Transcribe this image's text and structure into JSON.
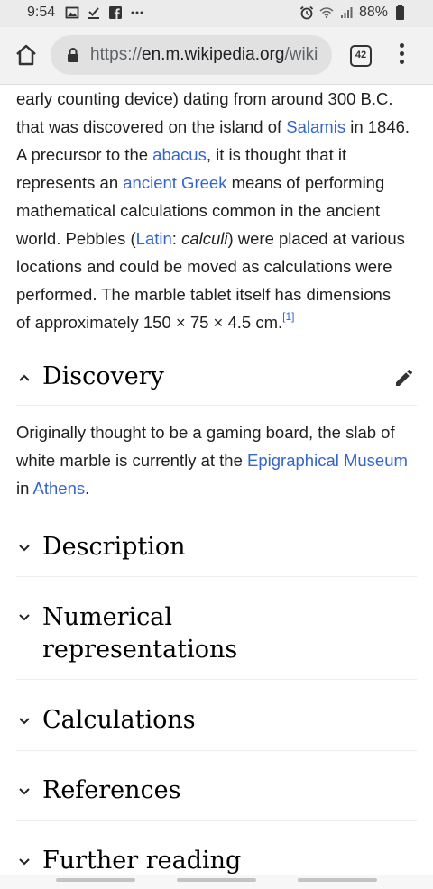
{
  "status_bar": {
    "time": "9:54",
    "battery": "88%",
    "left_icons": [
      "image-icon",
      "download-done-icon",
      "facebook-icon",
      "more-dots-icon"
    ],
    "right_icons": [
      "alarm-icon",
      "wifi-icon",
      "signal-icon",
      "battery-icon"
    ]
  },
  "browser": {
    "url_scheme": "https://",
    "url_host": "en.m.wikipedia.org",
    "url_path": "/wiki",
    "tab_count": "42"
  },
  "article": {
    "lines": [
      "early counting device) dating from around 300 B.C.",
      "that was discovered on the island of ",
      "Salamis",
      " in 1846.",
      "A precursor to the ",
      "abacus",
      ", it is thought that it",
      "represents an ",
      "ancient Greek",
      " means of performing",
      "mathematical calculations common in the ancient",
      "world. Pebbles (",
      "Latin",
      ": ",
      "calculi",
      ") were placed at various",
      "locations and could be moved as calculations were",
      "performed. The marble tablet itself has dimensions",
      "of approximately 150 × 75 × 4.5 cm.",
      "[1]"
    ],
    "discovery": {
      "title": "Discovery",
      "text_1": "Originally thought to be a gaming board, the slab of",
      "text_2": "white marble is currently at the ",
      "link_museum": "Epigraphical Museum",
      "text_3": "in ",
      "link_athens": "Athens",
      "text_4": "."
    },
    "sections": [
      "Description",
      "Numerical representations",
      "Calculations",
      "References",
      "Further reading"
    ],
    "section_numerical_line1": "Numerical",
    "section_numerical_line2": "representations"
  },
  "colors": {
    "link": "#3366cc",
    "text": "#202122",
    "heading": "#000000"
  }
}
